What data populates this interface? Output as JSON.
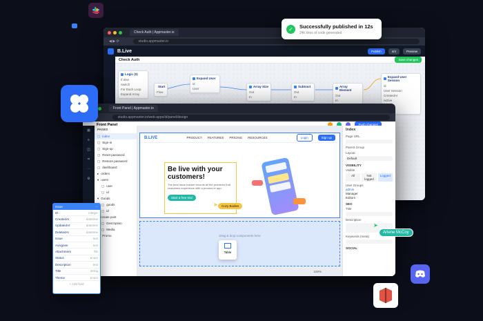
{
  "toast": {
    "title": "Successfully published in 12s",
    "subtitle": "24k lines of code generated"
  },
  "win1": {
    "tab": "Check Auth | Appmaster.io",
    "url": "studio.appmaster.io",
    "brand": "B.Live",
    "page": "Check Auth",
    "publish": "Publish",
    "count": "4/4",
    "preview": "Preview",
    "save": "Save changes",
    "nodes": [
      {
        "title": "Logic (0)",
        "ports": [
          "If else",
          "Switch",
          "For Each Loop",
          "Expand Array"
        ]
      },
      {
        "title": "Start",
        "ports": [
          "Flow"
        ]
      },
      {
        "title": "Expand User",
        "ports": [
          "id",
          "User"
        ]
      },
      {
        "title": "Array Size",
        "ports": [
          "Out",
          "In"
        ]
      },
      {
        "title": "Subtract",
        "ports": [
          "Out",
          "In"
        ]
      },
      {
        "title": "Array Element",
        "ports": [
          "Out",
          "In"
        ]
      },
      {
        "title": "Expand User Session",
        "ports": [
          "id",
          "User Session",
          "CreatedAt",
          "Active",
          "Token",
          "Expires"
        ]
      }
    ]
  },
  "win2": {
    "tab": "Front Panel | Appmaster.io",
    "url": "studio.appmaster.io/web-apps/id/panel/design",
    "brand": "Front Panel",
    "pages_title": "PAGES",
    "push": "Push changes",
    "pages": [
      "index",
      "Sign-in",
      "Sign-up",
      "Reset password",
      "Restore password",
      "dashboard",
      "orders",
      "users",
      "user",
      "id",
      "Goods",
      "goods",
      "id",
      "create post",
      "Description",
      "Media",
      "Promo"
    ],
    "site": {
      "logo": "B.LIVE",
      "nav": [
        "PRODUCT",
        "FEATURES",
        "PRICING",
        "RESOURCES"
      ],
      "login": "Login",
      "signup": "Sign up",
      "headline": "Be live with your customers!",
      "sub": "The best issue tracker records all the problems that customers experience with a product or app.",
      "cta": "Start a free trial"
    },
    "block": "Drag & drop components here",
    "table_label": "Table",
    "zoom": "100%",
    "right": {
      "title": "Index",
      "fields": [
        "Page URL",
        "Parent Group",
        "Layout",
        "Default",
        "VISIBILITY",
        "Visible",
        "All",
        "Not logged",
        "Logged",
        "User Groups",
        "admin",
        "Manager",
        "Editors",
        "SEO",
        "Title",
        "Description",
        "Keywords (meta)",
        "SOCIAL"
      ]
    }
  },
  "table": {
    "title": "Issue",
    "rows": [
      [
        "ID",
        "integer"
      ],
      [
        "CreatedAt",
        "datetime"
      ],
      [
        "UpdatedAt",
        "datetime"
      ],
      [
        "DeletedAt",
        "datetime"
      ],
      [
        "Issue",
        "text"
      ],
      [
        "Assignee",
        "text"
      ],
      [
        "Attachment",
        "file"
      ],
      [
        "Status",
        "enum"
      ],
      [
        "Description",
        "text"
      ],
      [
        "Title",
        "string"
      ],
      [
        "Theme",
        "enum"
      ]
    ],
    "add": "+ Add field"
  },
  "cursors": {
    "cozy": "Cozy Bodies",
    "arlene": "Arlene McCoy"
  },
  "colors": {
    "brand": "#2d6cf6",
    "bg": "#0c0f1a",
    "success": "#22c55e",
    "discord": "#5865f2",
    "aws": "#e05243"
  }
}
